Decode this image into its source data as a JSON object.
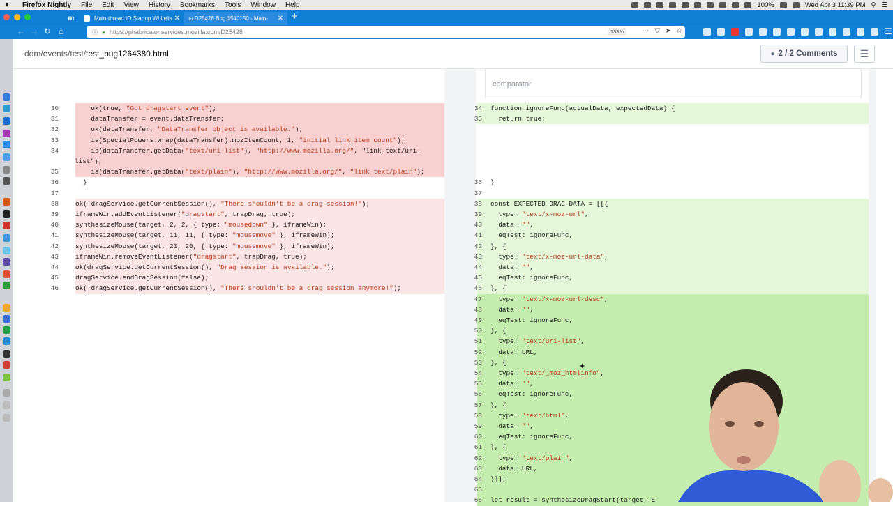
{
  "menubar": {
    "app": "Firefox Nightly",
    "items": [
      "File",
      "Edit",
      "View",
      "History",
      "Bookmarks",
      "Tools",
      "Window",
      "Help"
    ],
    "battery": "100%",
    "clock": "Wed Apr 3  11:39 PM"
  },
  "tabs": [
    {
      "label": "m",
      "pinned": true
    },
    {
      "label": "Main-thread IO Startup Whitelis",
      "active": false
    },
    {
      "label": "⊙ D25428 Bug 1540150 - Main-",
      "active": true
    }
  ],
  "url": "https://phabricator.services.mozilla.com/D25428",
  "zoom": "133%",
  "header": {
    "path_prefix": "dom/events/test/",
    "file": "test_bug1264380.html",
    "comments": "2 / 2 Comments"
  },
  "comparator_placeholder": "comparator",
  "left_lines": [
    {
      "n": "30",
      "text": "  ok(true, \"Got dragstart event\");",
      "type": "del-strong"
    },
    {
      "n": "31",
      "text": "  dataTransfer = event.dataTransfer;",
      "type": "del-strong"
    },
    {
      "n": "32",
      "text": "  ok(dataTransfer, \"DataTransfer object is available.\");",
      "type": "del-strong"
    },
    {
      "n": "33",
      "text": "  is(SpecialPowers.wrap(dataTransfer).mozItemCount, 1, \"initial link item count\");",
      "type": "del-strong"
    },
    {
      "n": "34",
      "text": "  is(dataTransfer.getData(\"text/uri-list\"), \"http://www.mozilla.org/\", \"link text/uri-",
      "type": "del-strong"
    },
    {
      "n": "",
      "text": "list\");",
      "type": "del-strong",
      "wrap": true
    },
    {
      "n": "35",
      "text": "  is(dataTransfer.getData(\"text/plain\"), \"http://www.mozilla.org/\", \"link text/plain\");",
      "type": "del-strong"
    },
    {
      "n": "36",
      "text": "}",
      "type": ""
    },
    {
      "n": "37",
      "text": "",
      "type": ""
    },
    {
      "n": "38",
      "text": "ok(!dragService.getCurrentSession(), \"There shouldn't be a drag session!\");",
      "type": "del"
    },
    {
      "n": "39",
      "text": "iframeWin.addEventListener(\"dragstart\", trapDrag, true);",
      "type": "del"
    },
    {
      "n": "40",
      "text": "synthesizeMouse(target, 2, 2, { type: \"mousedown\" }, iframeWin);",
      "type": "del"
    },
    {
      "n": "41",
      "text": "synthesizeMouse(target, 11, 11, { type: \"mousemove\" }, iframeWin);",
      "type": "del"
    },
    {
      "n": "42",
      "text": "synthesizeMouse(target, 20, 20, { type: \"mousemove\" }, iframeWin);",
      "type": "del"
    },
    {
      "n": "43",
      "text": "iframeWin.removeEventListener(\"dragstart\", trapDrag, true);",
      "type": "del"
    },
    {
      "n": "44",
      "text": "ok(dragService.getCurrentSession(), \"Drag session is available.\");",
      "type": "del"
    },
    {
      "n": "45",
      "text": "dragService.endDragSession(false);",
      "type": "del"
    },
    {
      "n": "46",
      "text": "ok(!dragService.getCurrentSession(), \"There shouldn't be a drag session anymore!\");",
      "type": "del"
    }
  ],
  "right_lines": [
    {
      "n": "34",
      "text": "function ignoreFunc(actualData, expectedData) {",
      "type": "add"
    },
    {
      "n": "35",
      "text": "  return true;",
      "type": "add"
    },
    {
      "n": "36",
      "text": "}",
      "type": ""
    },
    {
      "n": "37",
      "text": "",
      "type": ""
    },
    {
      "n": "38",
      "text": "const EXPECTED_DRAG_DATA = [[{",
      "type": "add"
    },
    {
      "n": "39",
      "text": "  type: \"text/x-moz-url\",",
      "type": "add"
    },
    {
      "n": "40",
      "text": "  data: \"\",",
      "type": "add"
    },
    {
      "n": "41",
      "text": "  eqTest: ignoreFunc,",
      "type": "add"
    },
    {
      "n": "42",
      "text": "}, {",
      "type": "add"
    },
    {
      "n": "43",
      "text": "  type: \"text/x-moz-url-data\",",
      "type": "add"
    },
    {
      "n": "44",
      "text": "  data: \"\",",
      "type": "add"
    },
    {
      "n": "45",
      "text": "  eqTest: ignoreFunc,",
      "type": "add"
    },
    {
      "n": "46",
      "text": "}, {",
      "type": "add"
    },
    {
      "n": "47",
      "text": "  type: \"text/x-moz-url-desc\",",
      "type": "add-strong"
    },
    {
      "n": "48",
      "text": "  data: \"\",",
      "type": "add-strong"
    },
    {
      "n": "49",
      "text": "  eqTest: ignoreFunc,",
      "type": "add-strong"
    },
    {
      "n": "50",
      "text": "}, {",
      "type": "add-strong"
    },
    {
      "n": "51",
      "text": "  type: \"text/uri-list\",",
      "type": "add-strong"
    },
    {
      "n": "52",
      "text": "  data: URL,",
      "type": "add-strong"
    },
    {
      "n": "53",
      "text": "}, {",
      "type": "add-strong"
    },
    {
      "n": "54",
      "text": "  type: \"text/_moz_htmlinfo\",",
      "type": "add-strong"
    },
    {
      "n": "55",
      "text": "  data: \"\",",
      "type": "add-strong"
    },
    {
      "n": "56",
      "text": "  eqTest: ignoreFunc,",
      "type": "add-strong"
    },
    {
      "n": "57",
      "text": "}, {",
      "type": "add-strong"
    },
    {
      "n": "58",
      "text": "  type: \"text/html\",",
      "type": "add-strong"
    },
    {
      "n": "59",
      "text": "  data: \"\",",
      "type": "add-strong"
    },
    {
      "n": "60",
      "text": "  eqTest: ignoreFunc,",
      "type": "add-strong"
    },
    {
      "n": "61",
      "text": "}, {",
      "type": "add-strong"
    },
    {
      "n": "62",
      "text": "  type: \"text/plain\",",
      "type": "add-strong"
    },
    {
      "n": "63",
      "text": "  data: URL,",
      "type": "add-strong"
    },
    {
      "n": "64",
      "text": "}]];",
      "type": "add-strong"
    },
    {
      "n": "65",
      "text": "",
      "type": "add-strong"
    },
    {
      "n": "66",
      "text": "let result = synthesizeDragStart(target, E",
      "type": "add-strong"
    }
  ],
  "colors": {
    "firefox_blue": "#0e7fd4",
    "deleted_bg": "#f8d0d0",
    "added_bg": "#c6edb0",
    "string_color": "#b3381a"
  }
}
